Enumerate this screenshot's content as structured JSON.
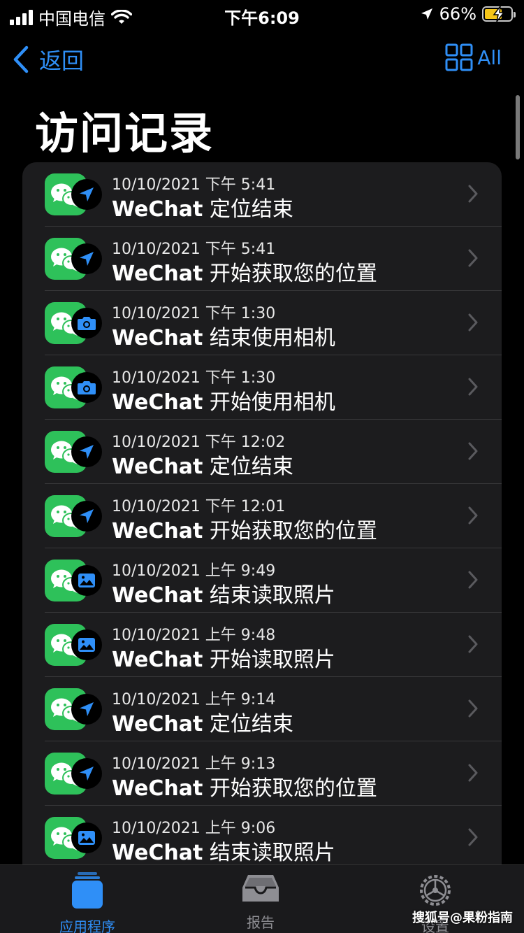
{
  "status_bar": {
    "carrier": "中国电信",
    "time": "下午6:09",
    "battery_percent": "66%",
    "battery_level": 0.66
  },
  "nav": {
    "back_label": "返回",
    "all_label": "All"
  },
  "page_title": "访问记录",
  "rows": [
    {
      "time": "10/10/2021 下午 5:41",
      "app": "WeChat",
      "action": "定位结束",
      "icon": "location-arrow-icon"
    },
    {
      "time": "10/10/2021 下午 5:41",
      "app": "WeChat",
      "action": "开始获取您的位置",
      "icon": "location-arrow-icon"
    },
    {
      "time": "10/10/2021 下午 1:30",
      "app": "WeChat",
      "action": "结束使用相机",
      "icon": "camera-icon"
    },
    {
      "time": "10/10/2021 下午 1:30",
      "app": "WeChat",
      "action": "开始使用相机",
      "icon": "camera-icon"
    },
    {
      "time": "10/10/2021 下午 12:02",
      "app": "WeChat",
      "action": "定位结束",
      "icon": "location-arrow-icon"
    },
    {
      "time": "10/10/2021 下午 12:01",
      "app": "WeChat",
      "action": "开始获取您的位置",
      "icon": "location-arrow-icon"
    },
    {
      "time": "10/10/2021 上午 9:49",
      "app": "WeChat",
      "action": "结束读取照片",
      "icon": "photo-icon"
    },
    {
      "time": "10/10/2021 上午 9:48",
      "app": "WeChat",
      "action": "开始读取照片",
      "icon": "photo-icon"
    },
    {
      "time": "10/10/2021 上午 9:14",
      "app": "WeChat",
      "action": "定位结束",
      "icon": "location-arrow-icon"
    },
    {
      "time": "10/10/2021 上午 9:13",
      "app": "WeChat",
      "action": "开始获取您的位置",
      "icon": "location-arrow-icon"
    },
    {
      "time": "10/10/2021 上午 9:06",
      "app": "WeChat",
      "action": "结束读取照片",
      "icon": "photo-icon"
    }
  ],
  "tabs": [
    {
      "label": "应用程序",
      "icon": "app-square-icon",
      "active": true
    },
    {
      "label": "报告",
      "icon": "tray-icon",
      "active": false
    },
    {
      "label": "设置",
      "icon": "gear-icon",
      "active": false
    }
  ],
  "watermark": "搜狐号@果粉指南",
  "colors": {
    "accent": "#2f8ff7",
    "wechat_green": "#2ec15a",
    "list_bg": "#1c1c1e",
    "separator": "#38383a"
  }
}
